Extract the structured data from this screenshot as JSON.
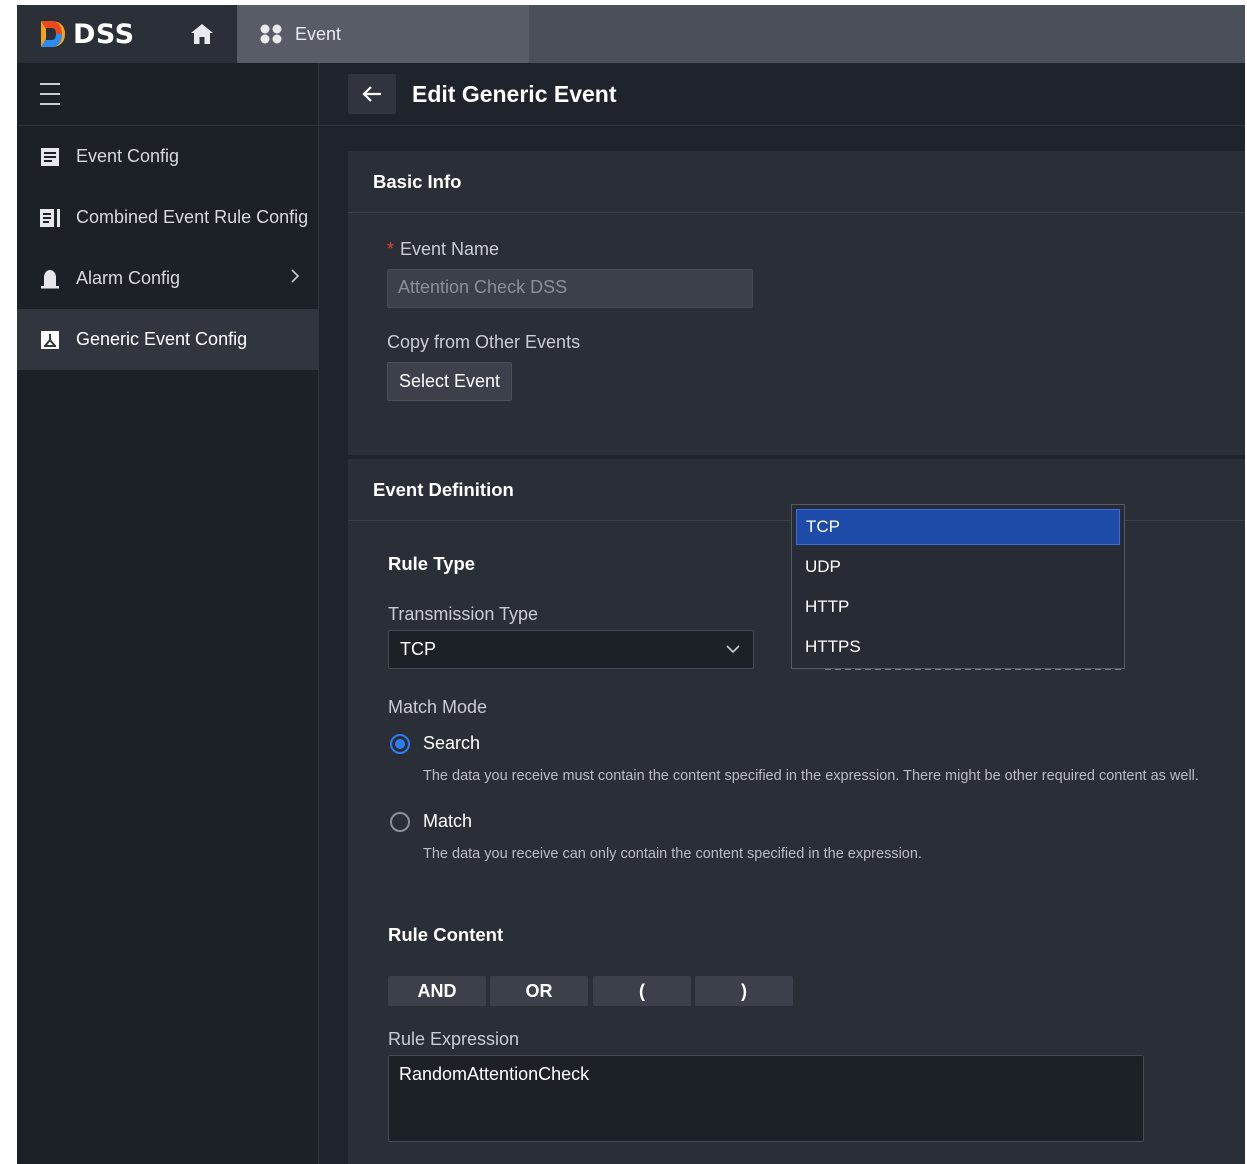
{
  "header": {
    "logo_text": "DSS",
    "active_tab": "Event",
    "colors": {
      "topbar": "#4a4f5a",
      "accent": "#2e7cf6"
    }
  },
  "sidebar": {
    "items": [
      {
        "label": "Event Config",
        "icon": "document-icon"
      },
      {
        "label": "Combined Event Rule Config",
        "icon": "combined-doc-icon"
      },
      {
        "label": "Alarm Config",
        "icon": "alarm-bell-icon"
      },
      {
        "label": "Generic Event Config",
        "icon": "generic-event-icon",
        "active": true
      }
    ]
  },
  "main": {
    "title": "Edit Generic Event",
    "basic_info": {
      "header": "Basic Info",
      "event_name_label": "Event Name",
      "event_name_value": "Attention Check DSS",
      "copy_label": "Copy from Other Events",
      "select_event_button": "Select Event"
    },
    "event_definition": {
      "header": "Event Definition",
      "rule_type_title": "Rule Type",
      "transmission_label": "Transmission Type",
      "transmission_value": "TCP",
      "match_mode_label": "Match Mode",
      "search_label": "Search",
      "search_hint": "The data you receive must contain the content specified in the expression. There might be other required content as well.",
      "match_label": "Match",
      "match_hint": "The data you receive can only contain the content specified in the expression.",
      "rule_content_title": "Rule Content",
      "operators": [
        "AND",
        "OR",
        "(",
        ")"
      ],
      "rule_expression_label": "Rule Expression",
      "rule_expression_value": "RandomAttentionCheck",
      "match_mode_selected": "Search"
    },
    "dropdown_options": [
      "TCP",
      "UDP",
      "HTTP",
      "HTTPS"
    ],
    "dropdown_selected": "TCP"
  }
}
